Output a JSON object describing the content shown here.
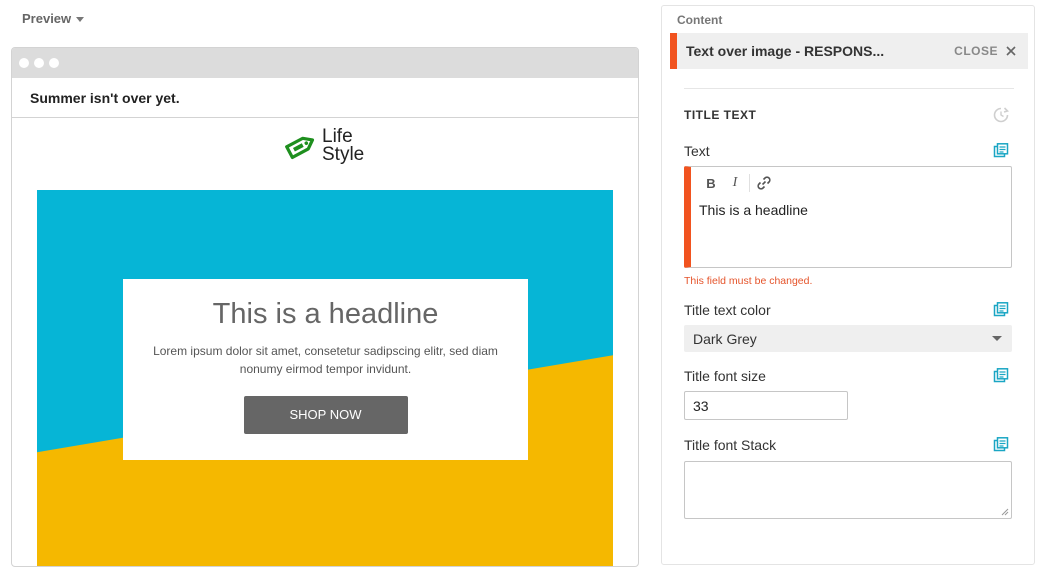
{
  "preview": {
    "header_label": "Preview",
    "email_subject": "Summer isn't over yet.",
    "logo_text_line1": "Life",
    "logo_text_line2": "Style",
    "hero": {
      "headline": "This is a headline",
      "body": "Lorem ipsum dolor sit amet, consetetur sadipscing elitr, sed diam nonumy eirmod tempor invidunt.",
      "button_label": "SHOP NOW"
    }
  },
  "content_panel": {
    "label": "Content",
    "block_title": "Text over image - RESPONS...",
    "close_label": "CLOSE",
    "section_title": "TITLE TEXT",
    "fields": {
      "text_label": "Text",
      "text_value": "This is a headline",
      "text_error": "This field must be changed.",
      "color_label": "Title text color",
      "color_value": "Dark Grey",
      "size_label": "Title font size",
      "size_value": "33",
      "stack_label": "Title font Stack",
      "stack_value": ""
    },
    "toolbar": {
      "bold_label": "B",
      "italic_label": "I"
    }
  },
  "colors": {
    "accent_orange": "#f1531f",
    "icon_teal": "#1aa6c4",
    "logo_green": "#1e8f1e",
    "hero_blue": "#06b5d6",
    "hero_yellow": "#f5b800",
    "error_red": "#e5542b"
  },
  "icons": {
    "caret": "chevron-down-icon",
    "close": "close-icon",
    "reset": "reset-icon",
    "copy": "copy-icon",
    "link": "link-icon",
    "logo": "tag-logo-icon"
  }
}
